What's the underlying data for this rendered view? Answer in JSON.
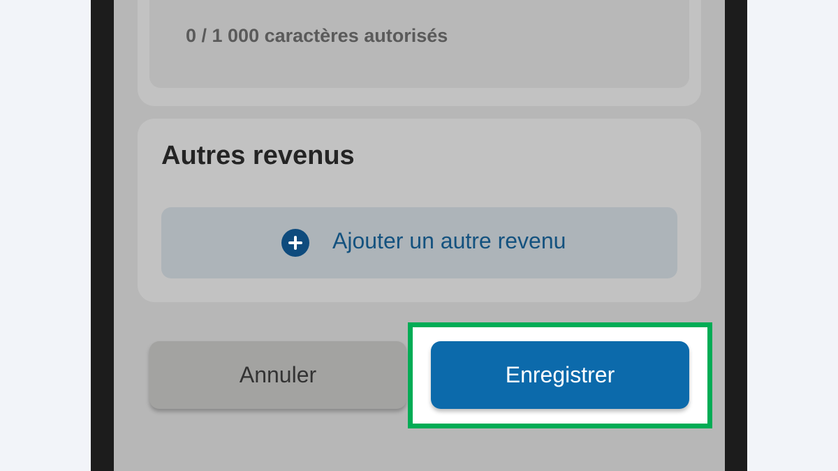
{
  "comment_section": {
    "char_counter": "0 / 1 000 caractères autorisés"
  },
  "other_income": {
    "title": "Autres revenus",
    "add_button_label": "Ajouter un autre revenu",
    "add_icon": "plus-circle-icon"
  },
  "actions": {
    "cancel_label": "Annuler",
    "save_label": "Enregistrer",
    "highlight_color": "#00ac55",
    "primary_color": "#0c6aab"
  }
}
